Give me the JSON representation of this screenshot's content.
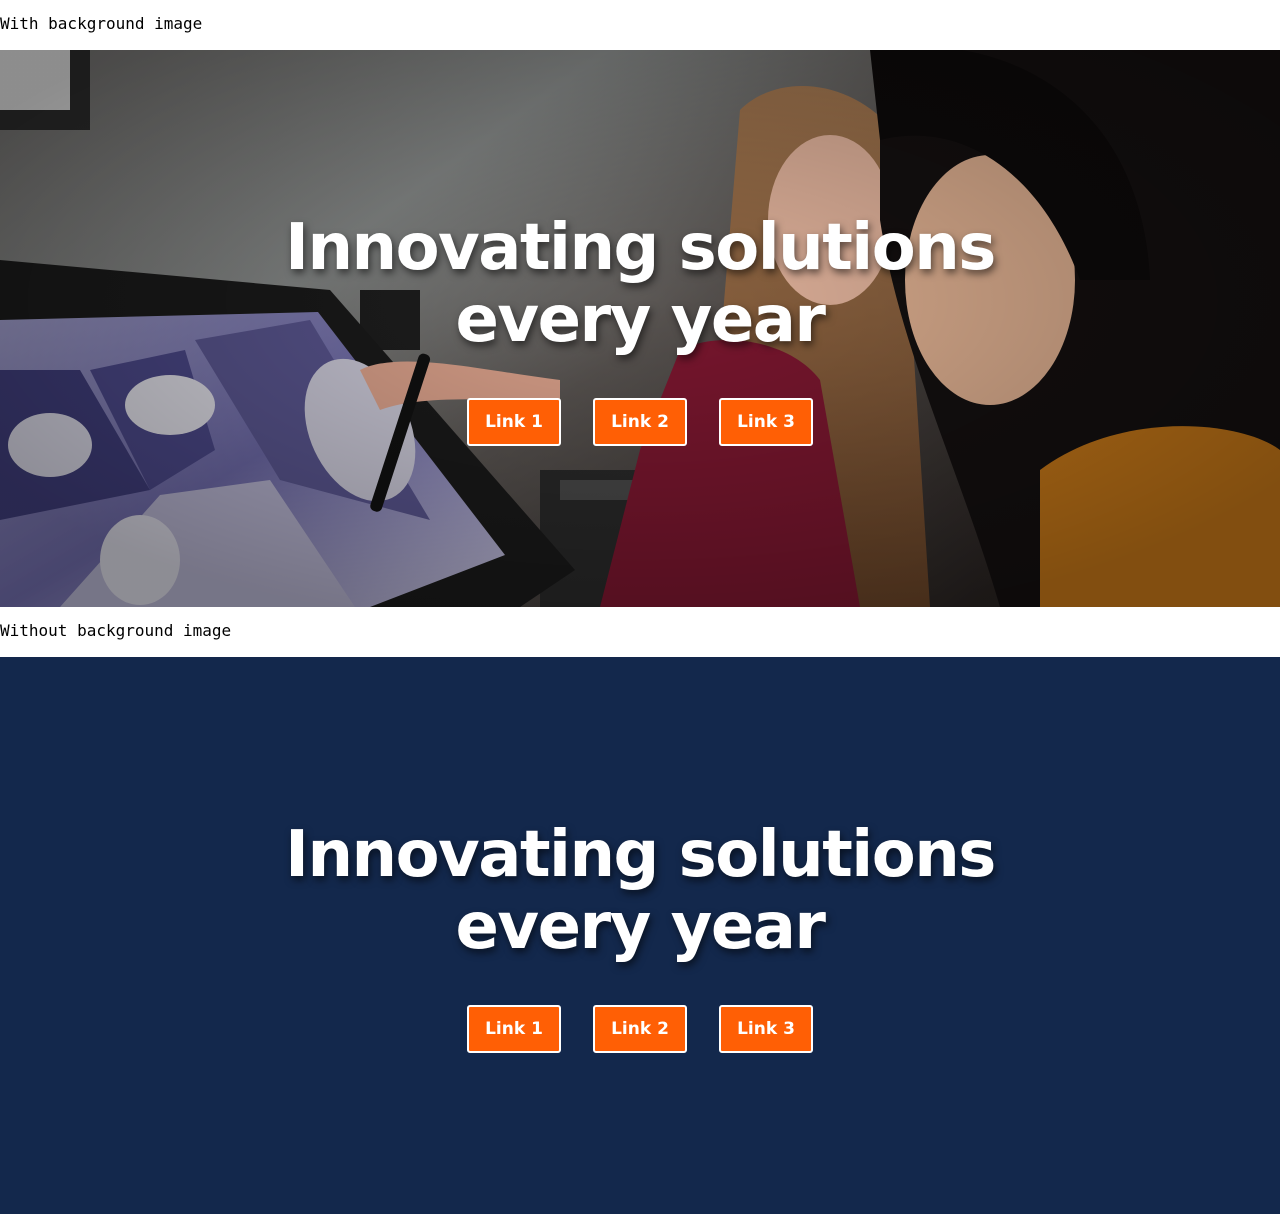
{
  "colors": {
    "plain_background": "#13284c",
    "link_background": "#ff5f05",
    "link_border": "#ffffff",
    "heading_text": "#ffffff"
  },
  "sections": [
    {
      "label": "With background image",
      "hero": {
        "background": "photo",
        "heading_line1": "Innovating solutions",
        "heading_line2": "every year",
        "links": [
          "Link 1",
          "Link 2",
          "Link 3"
        ]
      }
    },
    {
      "label": "Without background image",
      "hero": {
        "background": "solid",
        "heading_line1": "Innovating solutions",
        "heading_line2": "every year",
        "links": [
          "Link 1",
          "Link 2",
          "Link 3"
        ]
      }
    }
  ]
}
